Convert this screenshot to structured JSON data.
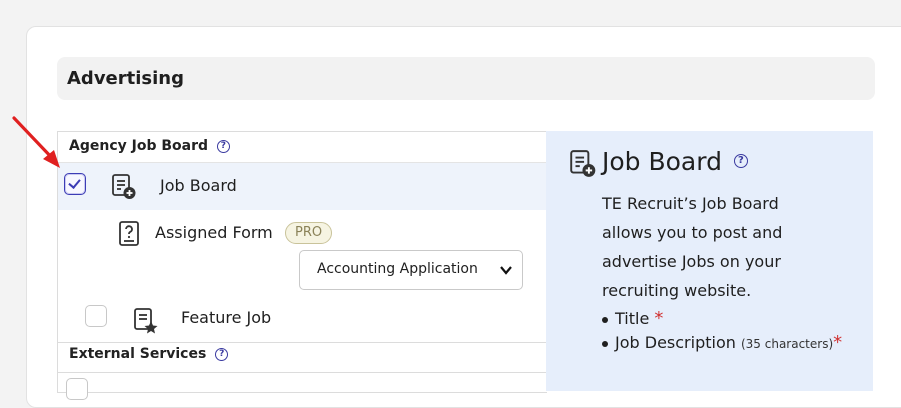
{
  "section": {
    "title": "Advertising"
  },
  "groups": {
    "agency": {
      "label": "Agency Job Board"
    },
    "external": {
      "label": "External Services"
    }
  },
  "items": {
    "job_board": {
      "label": "Job Board",
      "checked": true
    },
    "assigned_form": {
      "label": "Assigned Form",
      "badge": "PRO"
    },
    "form_select": {
      "value": "Accounting Application"
    },
    "feature_job": {
      "label": "Feature Job",
      "checked": false
    }
  },
  "info": {
    "title": "Job Board",
    "description": "TE Recruit’s Job Board allows you to post and advertise Jobs on your recruiting website.",
    "fields": [
      {
        "label": "Title",
        "note": "",
        "required": "*"
      },
      {
        "label": "Job Description",
        "note": "(35 characters)",
        "required": "*"
      }
    ]
  },
  "help_glyph": "?",
  "colors": {
    "accent": "#3c3cb5",
    "required": "#d03030",
    "panel": "#e6eefb",
    "arrow": "#e02020"
  }
}
